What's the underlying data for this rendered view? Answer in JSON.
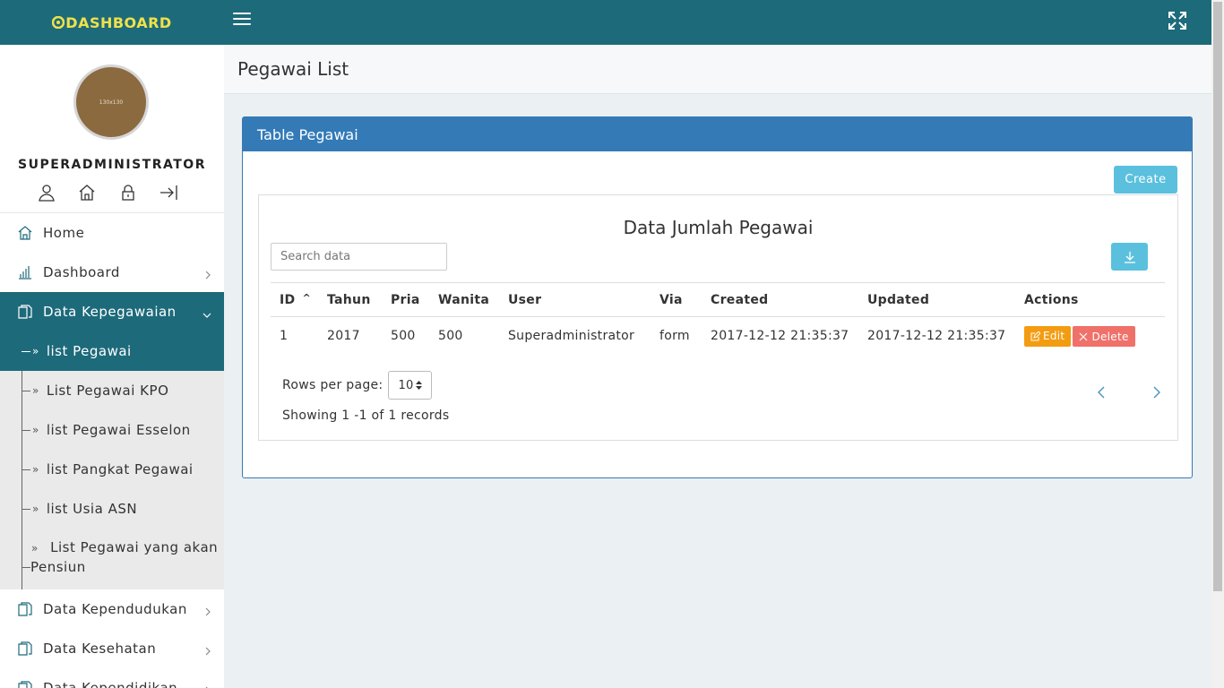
{
  "app": {
    "brand": "DASHBOARD"
  },
  "profile": {
    "avatar_text": "130x130",
    "username": "SUPERADMINISTRATOR"
  },
  "sidebar": {
    "items": [
      {
        "label": "Home",
        "icon": "home-icon"
      },
      {
        "label": "Dashboard",
        "icon": "bar-chart-icon"
      },
      {
        "label": "Data Kepegawaian",
        "icon": "document-icon",
        "expanded": true
      }
    ],
    "subitems": [
      {
        "label": "list Pegawai",
        "active": true
      },
      {
        "label": "List Pegawai KPO"
      },
      {
        "label": "list Pegawai Esselon"
      },
      {
        "label": "list Pangkat Pegawai"
      },
      {
        "label": "list Usia ASN"
      },
      {
        "label": "List Pegawai yang akan",
        "label2": "Pensiun"
      }
    ],
    "items_after": [
      {
        "label": "Data Kependudukan",
        "icon": "document-icon"
      },
      {
        "label": "Data Kesehatan",
        "icon": "document-icon"
      },
      {
        "label": "Data Kependidikan",
        "icon": "document-icon"
      }
    ]
  },
  "page": {
    "title": "Pegawai List"
  },
  "panel": {
    "title": "Table Pegawai",
    "create_label": "Create"
  },
  "card": {
    "title": "Data Jumlah Pegawai",
    "search_placeholder": "Search data"
  },
  "table": {
    "columns": [
      "ID",
      "Tahun",
      "Pria",
      "Wanita",
      "User",
      "Via",
      "Created",
      "Updated",
      "Actions"
    ],
    "rows": [
      {
        "id": "1",
        "tahun": "2017",
        "pria": "500",
        "wanita": "500",
        "user": "Superadministrator",
        "via": "form",
        "created": "2017-12-12 21:35:37",
        "updated": "2017-12-12 21:35:37"
      }
    ],
    "edit_label": "Edit",
    "delete_label": "Delete"
  },
  "pagination": {
    "rows_per_page_label": "Rows per page:",
    "rows_per_page_value": "10",
    "showing": "Showing 1 -1 of 1 records"
  },
  "colors": {
    "topbar": "#1d6a7a",
    "brand": "#f0e14a",
    "panel": "#337ab7",
    "info_button": "#5bc0de",
    "edit": "#f39c12",
    "delete": "#f0706a"
  }
}
